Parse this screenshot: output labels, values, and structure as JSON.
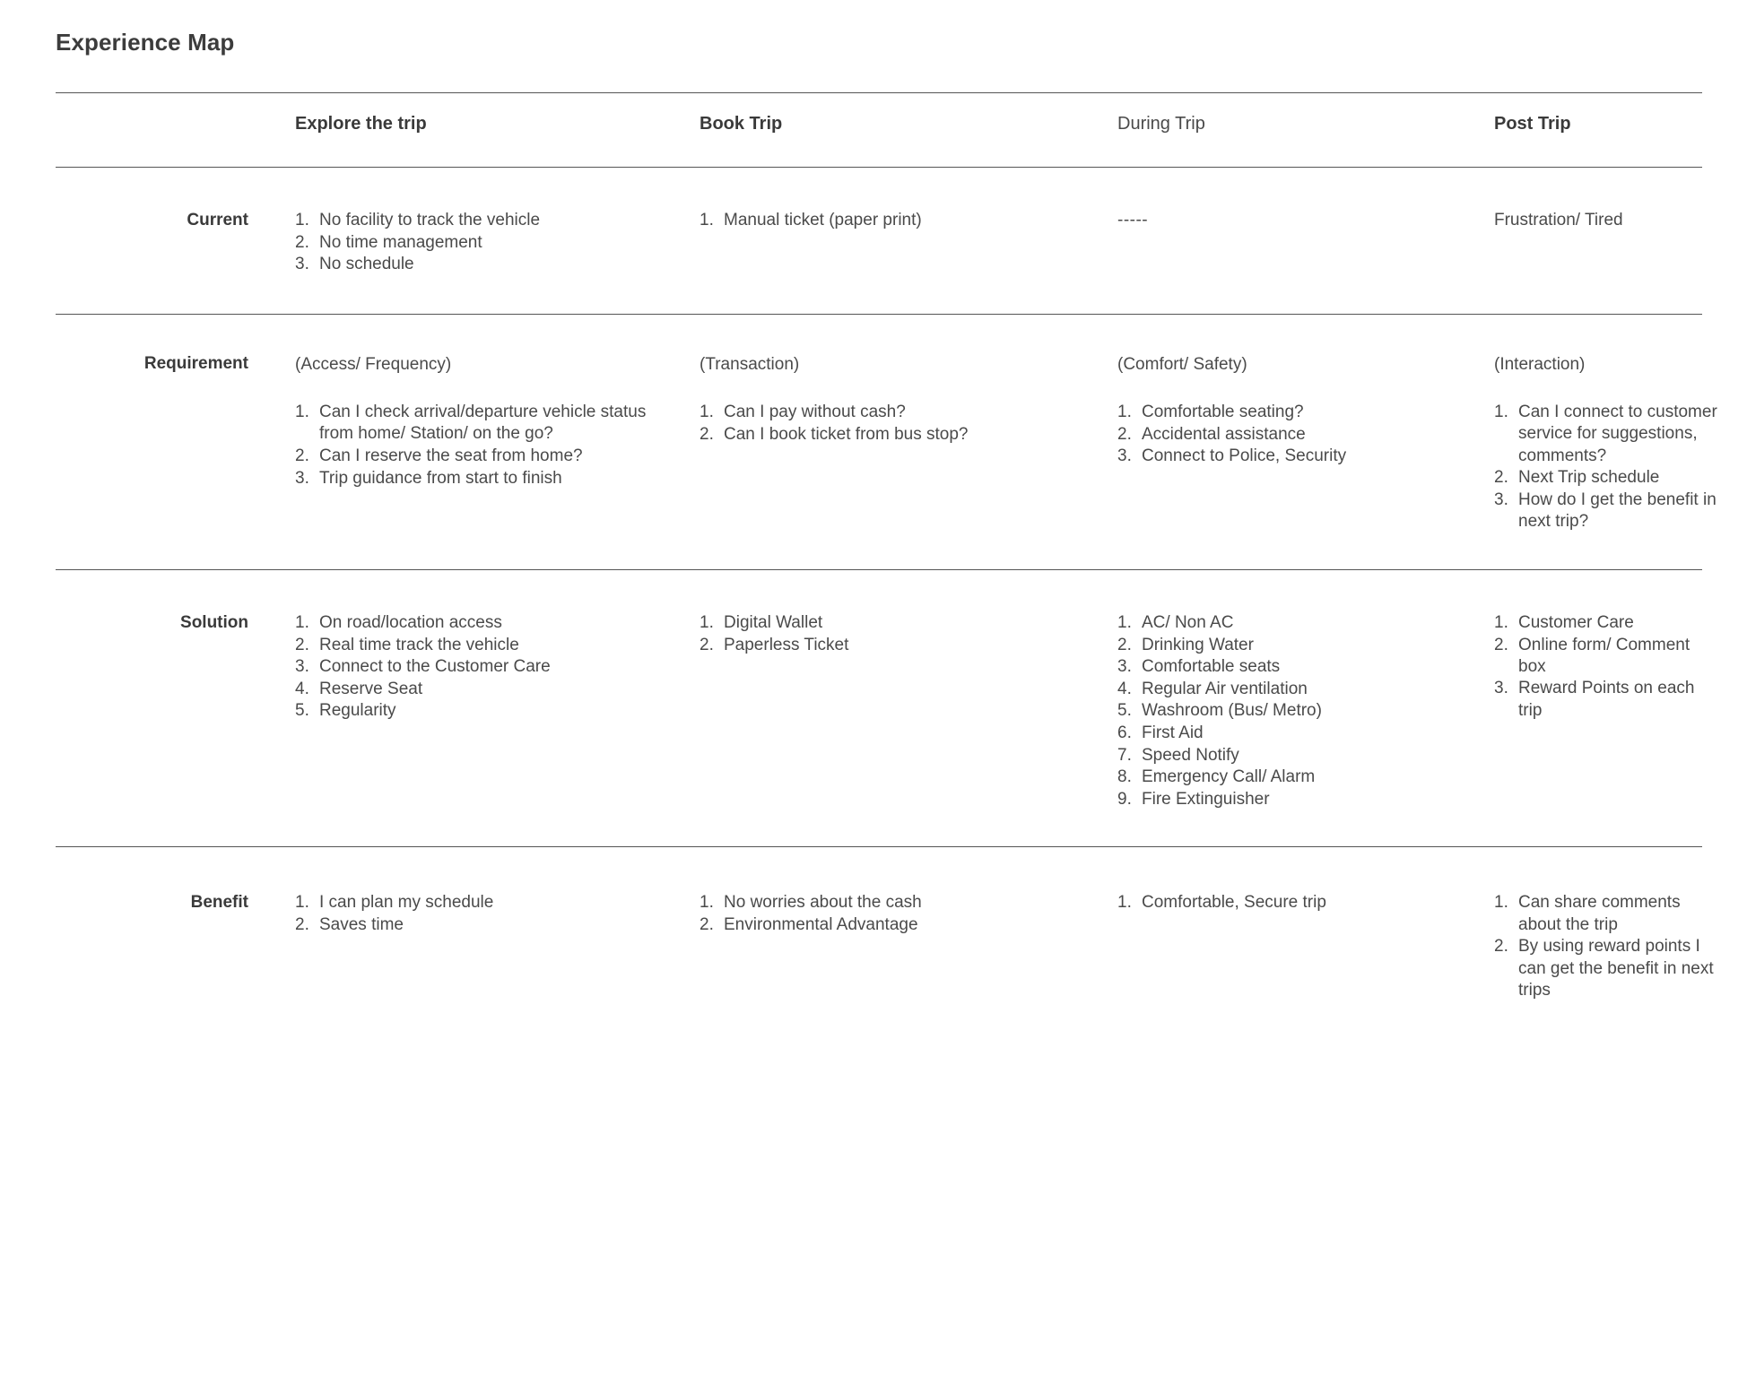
{
  "title": "Experience Map",
  "columns": [
    {
      "label": "Explore the trip",
      "bold": true
    },
    {
      "label": "Book Trip",
      "bold": true
    },
    {
      "label": "During Trip",
      "bold": false
    },
    {
      "label": "Post Trip",
      "bold": true
    }
  ],
  "rows": [
    {
      "label": "Current",
      "cells": [
        {
          "subhead": "",
          "items": [
            "No facility to track the vehicle",
            "No time management",
            "No schedule"
          ]
        },
        {
          "subhead": "",
          "items": [
            "Manual ticket (paper print)"
          ]
        },
        {
          "subhead": "",
          "items": [],
          "plain": "-----"
        },
        {
          "subhead": "",
          "items": [],
          "plain": "Frustration/ Tired"
        }
      ]
    },
    {
      "label": "Requirement",
      "cells": [
        {
          "subhead": "(Access/ Frequency)",
          "items": [
            "Can I check arrival/departure vehicle status from home/ Station/ on the go?",
            "Can I reserve the seat from home?",
            "Trip guidance from start to finish"
          ]
        },
        {
          "subhead": "(Transaction)",
          "items": [
            "Can I pay without cash?",
            "Can I book ticket from bus stop?"
          ]
        },
        {
          "subhead": "(Comfort/ Safety)",
          "items": [
            "Comfortable seating?",
            "Accidental assistance",
            "Connect to Police, Security"
          ]
        },
        {
          "subhead": "(Interaction)",
          "items": [
            "Can I connect to customer service for suggestions, comments?",
            "Next Trip schedule",
            "How do I get the benefit in next trip?"
          ]
        }
      ]
    },
    {
      "label": "Solution",
      "cells": [
        {
          "subhead": "",
          "items": [
            "On road/location access",
            "Real time track the vehicle",
            "Connect to the Customer Care",
            "Reserve Seat",
            "Regularity"
          ]
        },
        {
          "subhead": "",
          "items": [
            "Digital Wallet",
            "Paperless Ticket"
          ]
        },
        {
          "subhead": "",
          "items": [
            "AC/ Non AC",
            "Drinking Water",
            "Comfortable seats",
            "Regular Air ventilation",
            "Washroom (Bus/ Metro)",
            "First Aid",
            "Speed Notify",
            "Emergency Call/ Alarm",
            "Fire Extinguisher"
          ]
        },
        {
          "subhead": "",
          "items": [
            "Customer Care",
            "Online form/ Comment box",
            "Reward Points on each trip"
          ]
        }
      ]
    },
    {
      "label": "Benefit",
      "cells": [
        {
          "subhead": "",
          "items": [
            "I can plan my schedule",
            "Saves time"
          ]
        },
        {
          "subhead": "",
          "items": [
            "No worries about the cash",
            "Environmental Advantage"
          ]
        },
        {
          "subhead": "",
          "items": [
            "Comfortable, Secure trip"
          ]
        },
        {
          "subhead": "",
          "items": [
            "Can share comments about the trip",
            "By using reward points I can get the benefit in next trips"
          ]
        }
      ]
    }
  ],
  "colors": {
    "text": "#4a4a4a",
    "heading": "#3a3a3a",
    "rule": "#555555",
    "background": "#ffffff"
  }
}
